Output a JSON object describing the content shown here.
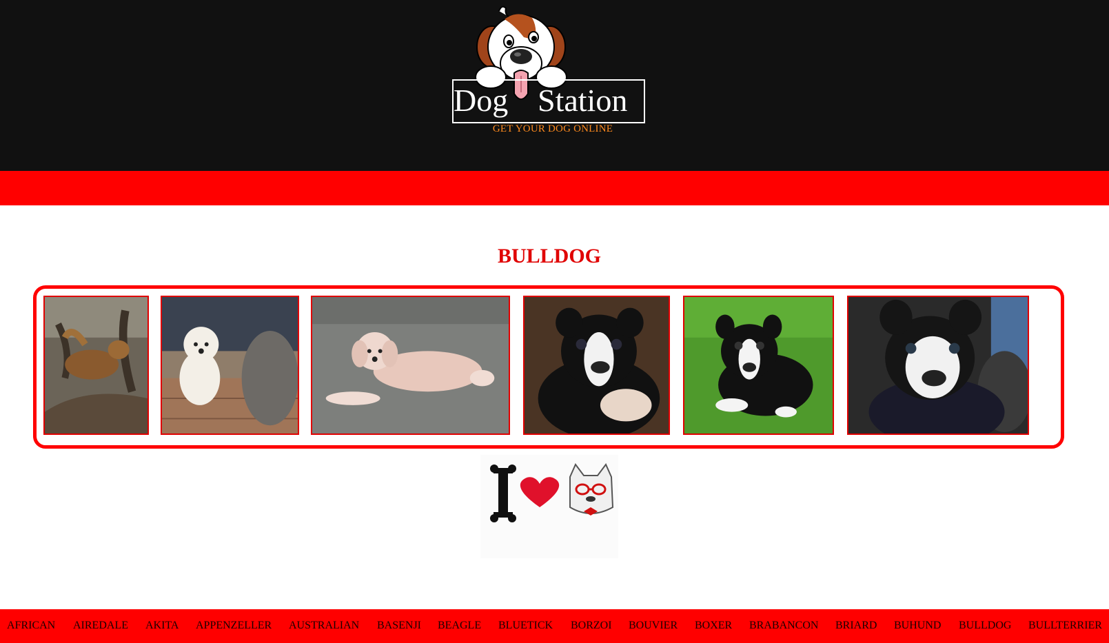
{
  "brand": {
    "name_part1": "Dog",
    "name_part2": "Station",
    "tagline": "GET YOUR DOG ONLINE"
  },
  "breed": {
    "title": "BULLDOG"
  },
  "gallery": {
    "photos": [
      {
        "subject": "dog-in-tree-photo"
      },
      {
        "subject": "white-poodle-with-elephant-photo"
      },
      {
        "subject": "pink-poodle-lying-photo"
      },
      {
        "subject": "boston-terrier-puppy-paw-photo"
      },
      {
        "subject": "boston-terrier-puppy-grass-photo"
      },
      {
        "subject": "boston-terrier-puppy-held-photo"
      }
    ]
  },
  "banner": {
    "icon": "i-love-frenchie-icon"
  },
  "nav": {
    "items": [
      "AFRICAN",
      "AIREDALE",
      "AKITA",
      "APPENZELLER",
      "AUSTRALIAN",
      "BASENJI",
      "BEAGLE",
      "BLUETICK",
      "BORZOI",
      "BOUVIER",
      "BOXER",
      "BRABANCON",
      "BRIARD",
      "BUHUND",
      "BULLDOG",
      "BULLTERRIER"
    ]
  },
  "colors": {
    "header_bg": "#111111",
    "accent_red": "#ff0000",
    "title_red": "#e00000",
    "tagline_orange": "#ff8a1e"
  }
}
